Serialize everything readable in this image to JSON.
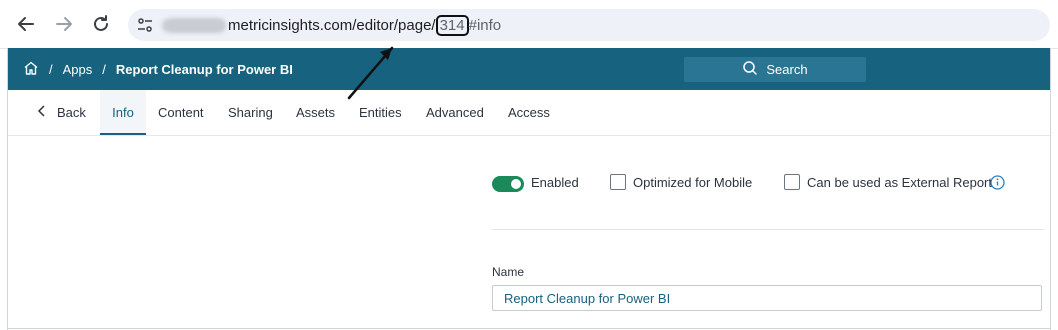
{
  "browser": {
    "url_domain": "metricinsights.com/editor/page/",
    "url_id": "314",
    "url_hash": "#info"
  },
  "header": {
    "breadcrumb": {
      "apps": "Apps",
      "separator": "/",
      "current": "Report Cleanup for Power BI"
    },
    "search_label": "Search"
  },
  "tabs": {
    "back": "Back",
    "items": [
      "Info",
      "Content",
      "Sharing",
      "Assets",
      "Entities",
      "Advanced",
      "Access"
    ],
    "active": "Info"
  },
  "options": {
    "enabled_label": "Enabled",
    "enabled": true,
    "mobile_label": "Optimized for Mobile",
    "mobile_checked": false,
    "external_label": "Can be used as External Report",
    "external_checked": false
  },
  "form": {
    "name_label": "Name",
    "name_value": "Report Cleanup for Power BI"
  },
  "colors": {
    "header_bg": "#16627f",
    "toggle_on": "#1a8a5a",
    "annotation": "#111111"
  },
  "icons": [
    "arrow-left-icon",
    "arrow-right-icon",
    "reload-icon",
    "site-settings-icon",
    "home-icon",
    "search-icon",
    "chevron-left-icon",
    "info-icon"
  ]
}
